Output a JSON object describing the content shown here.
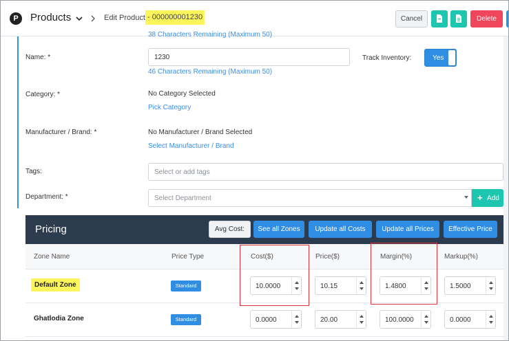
{
  "header": {
    "logo_letter": "P",
    "app_title": "Products",
    "edit_label": "Edit Product",
    "product_id": "- 000000001230",
    "cancel_label": "Cancel",
    "delete_label": "Delete"
  },
  "form": {
    "remaining_top": "38 Characters Remaining (Maximum 50)",
    "name_label": "Name: *",
    "name_value": "1230",
    "name_remaining": "46 Characters Remaining (Maximum 50)",
    "track_inventory_label": "Track Inventory:",
    "track_inventory_value": "Yes",
    "category_label": "Category: *",
    "category_value": "No Category Selected",
    "pick_category": "Pick Category",
    "manufacturer_label": "Manufacturer / Brand: *",
    "manufacturer_value": "No Manufacturer / Brand Selected",
    "select_manufacturer": "Select Manufacturer / Brand",
    "tags_label": "Tags:",
    "tags_placeholder": "Select or add tags",
    "department_label": "Department: *",
    "department_placeholder": "Select Department",
    "add_label": "Add"
  },
  "pricing": {
    "title": "Pricing",
    "buttons": {
      "avg_cost": "Avg Cost:",
      "see_all_zones": "See all Zones",
      "update_all_costs": "Update all Costs",
      "update_all_prices": "Update all Prices",
      "effective_price": "Effective Price"
    },
    "columns": [
      "Zone Name",
      "Price Type",
      "Cost($)",
      "Price($)",
      "Margin(%)",
      "Markup(%)"
    ],
    "rows": [
      {
        "zone": "Default Zone",
        "price_type": "Standard",
        "cost": "10.0000",
        "price": "10.15",
        "margin": "1.4800",
        "markup": "1.5000"
      },
      {
        "zone": "Ghatlodia Zone",
        "price_type": "Standard",
        "cost": "0.0000",
        "price": "20.00",
        "margin": "100.0000",
        "markup": "0.0000"
      }
    ]
  },
  "colors": {
    "accent_blue": "#2f8de4",
    "teal": "#1ec6b0",
    "danger": "#f0465c",
    "highlight": "#fdf65a",
    "pricing_header": "#2c3c4e",
    "annotation_red": "#e0343a"
  }
}
